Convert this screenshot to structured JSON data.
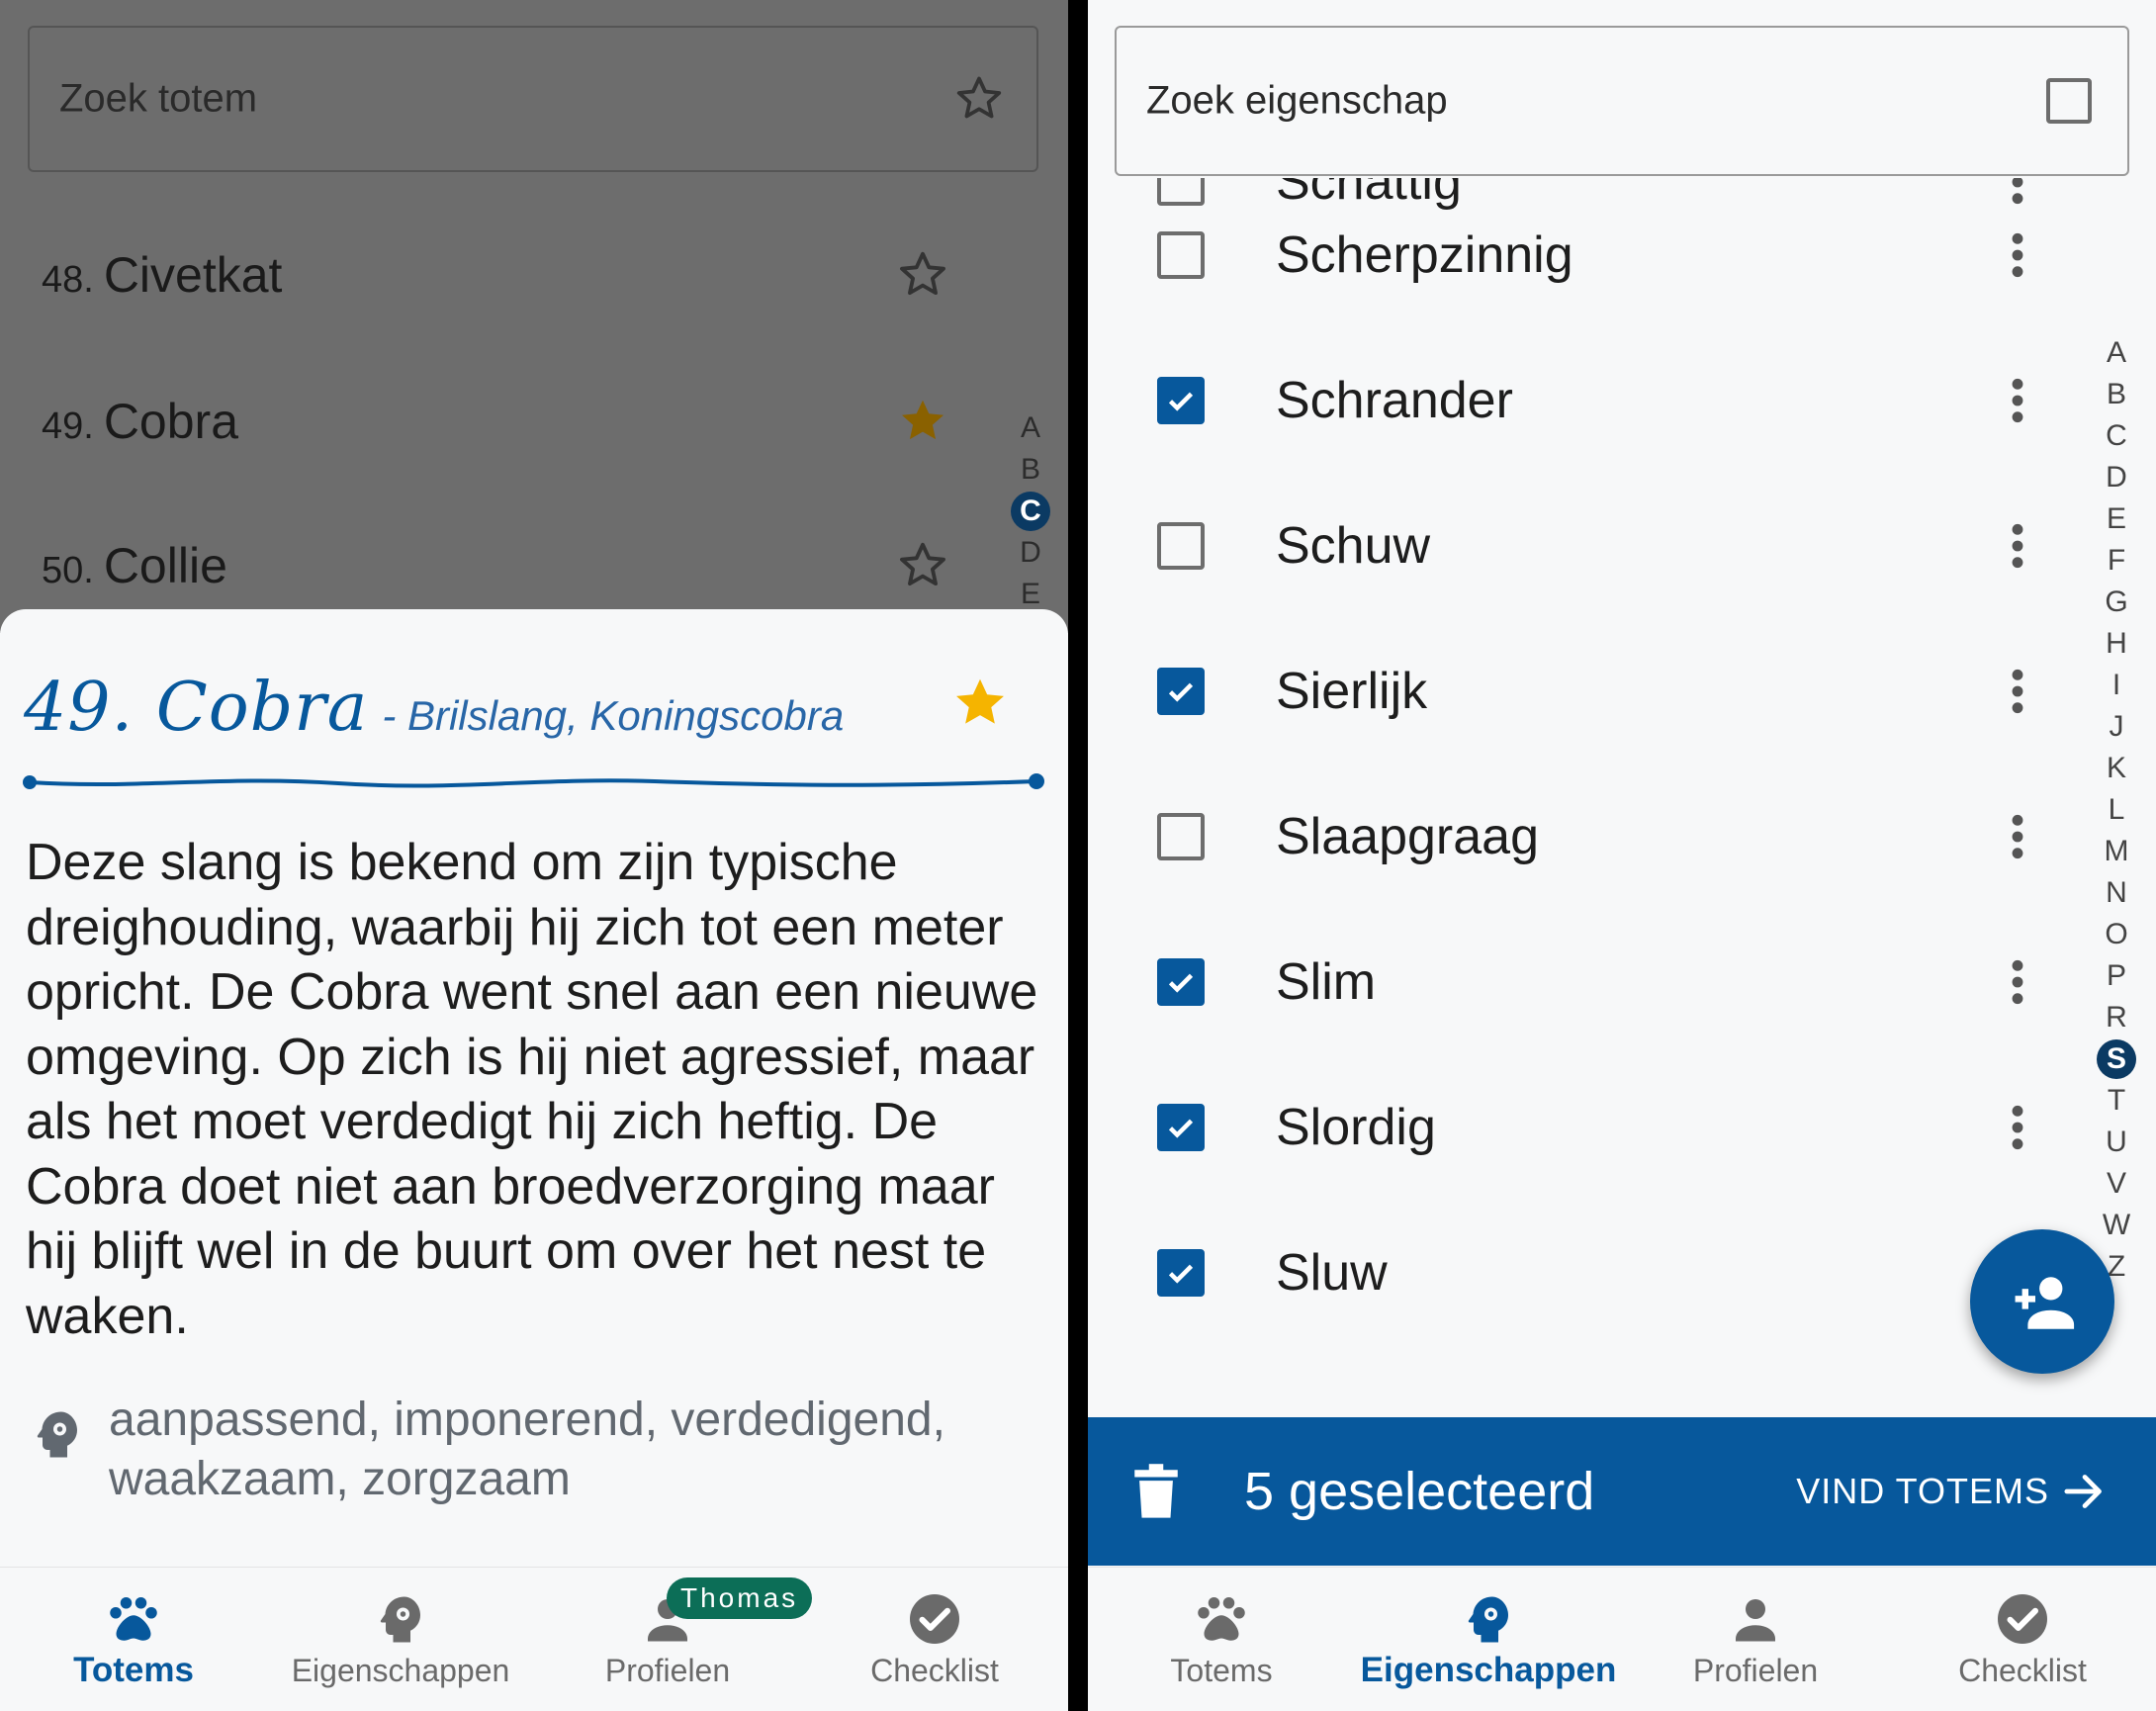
{
  "left": {
    "search": {
      "placeholder": "Zoek totem"
    },
    "totems": [
      {
        "num": "48.",
        "name": "Civetkat",
        "favorite": false
      },
      {
        "num": "49.",
        "name": "Cobra",
        "favorite": true
      },
      {
        "num": "50.",
        "name": "Collie",
        "favorite": false
      }
    ],
    "alphabet": [
      "A",
      "B",
      "C",
      "D",
      "E"
    ],
    "alphabet_active": "C",
    "detail": {
      "title": "49. Cobra",
      "alt_names": "- Brilslang, Koningscobra",
      "favorite": true,
      "description": "Deze slang is bekend om zijn typische dreighouding, waarbij hij zich tot een meter opricht. De Cobra went snel aan een nieuwe omgeving. Op zich is hij niet agressief, maar als het moet verdedigt hij zich heftig. De Cobra doet niet aan broedverzorging maar hij blijft wel in de buurt om over het nest te waken.",
      "traits": "aanpassend, imponerend, verdedigend, waakzaam, zorgzaam"
    },
    "nav": [
      {
        "label": "Totems",
        "icon": "paw-icon",
        "active": true
      },
      {
        "label": "Eigenschappen",
        "icon": "head-gear-icon",
        "active": false
      },
      {
        "label": "Profielen",
        "icon": "person-icon",
        "active": false
      },
      {
        "label": "Checklist",
        "icon": "check-circle-icon",
        "active": false
      }
    ],
    "profile_badge": "Thomas"
  },
  "right": {
    "search": {
      "placeholder": "Zoek eigenschap"
    },
    "properties": [
      {
        "name": "Schattig",
        "checked": false
      },
      {
        "name": "Scherpzinnig",
        "checked": false
      },
      {
        "name": "Schrander",
        "checked": true
      },
      {
        "name": "Schuw",
        "checked": false
      },
      {
        "name": "Sierlijk",
        "checked": true
      },
      {
        "name": "Slaapgraag",
        "checked": false
      },
      {
        "name": "Slim",
        "checked": true
      },
      {
        "name": "Slordig",
        "checked": true
      },
      {
        "name": "Sluw",
        "checked": true
      }
    ],
    "alphabet": [
      "A",
      "B",
      "C",
      "D",
      "E",
      "F",
      "G",
      "H",
      "I",
      "J",
      "K",
      "L",
      "M",
      "N",
      "O",
      "P",
      "R",
      "S",
      "T",
      "U",
      "V",
      "W",
      "Z"
    ],
    "alphabet_active": "S",
    "selection_bar": {
      "count_text": "5 geselecteerd",
      "action_label": "VIND TOTEMS"
    },
    "nav": [
      {
        "label": "Totems",
        "icon": "paw-icon",
        "active": false
      },
      {
        "label": "Eigenschappen",
        "icon": "head-gear-icon",
        "active": true
      },
      {
        "label": "Profielen",
        "icon": "person-icon",
        "active": false
      },
      {
        "label": "Checklist",
        "icon": "check-circle-icon",
        "active": false
      }
    ]
  },
  "colors": {
    "primary": "#07589c",
    "star_gold": "#f5b400",
    "star_dim": "#8a6100",
    "badge_green": "#0c6e57",
    "overlay": "#6d6d6d"
  }
}
